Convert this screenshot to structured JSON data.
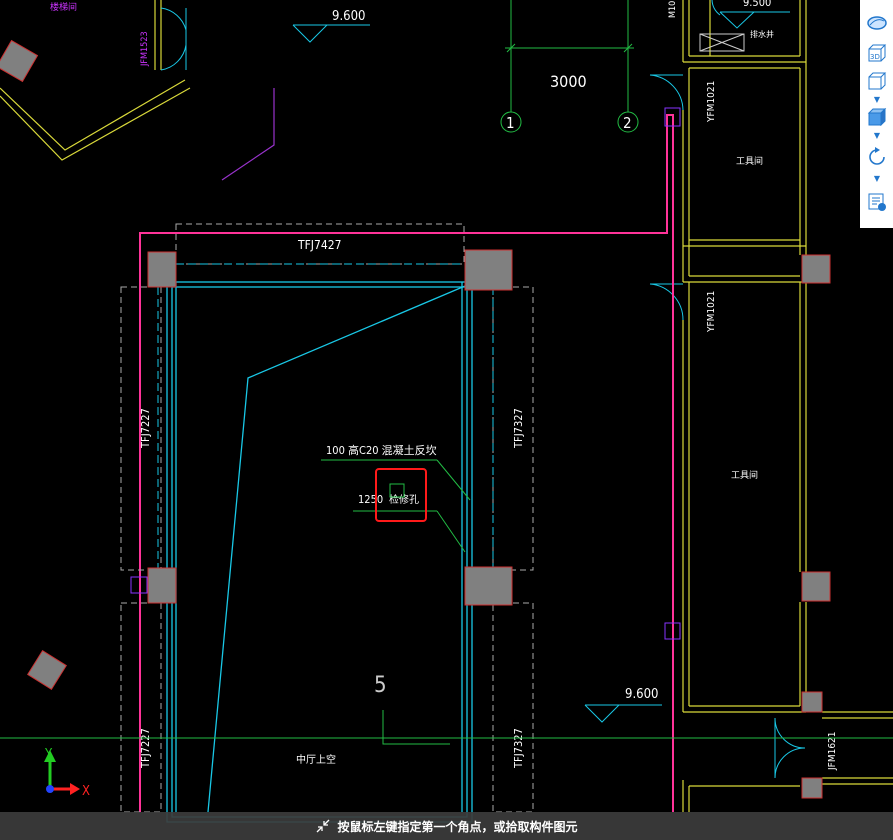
{
  "canvas": {
    "elevations": [
      "9.600",
      "9.600",
      "9.500"
    ],
    "dimension": "3000",
    "axes": [
      "1",
      "2"
    ],
    "room_number": "5",
    "beams": {
      "top": "TFJ7427",
      "left_upper": "TFJ7227",
      "right_upper": "TFJ7327",
      "left_lower": "TFJ7227",
      "right_lower": "TFJ7327"
    },
    "doors": {
      "right_upper": "YFM1021",
      "right_middle": "YFM1021",
      "left_top": "JFM1523",
      "right_lower": "JFM1621",
      "top_small": "M10"
    },
    "rooms": {
      "tool_room_1": "工具间",
      "tool_room_2": "工具间",
      "hall": "中厅上空",
      "well": "排水井"
    },
    "annotations": {
      "line1": "100 高C20 混凝土反坎",
      "line2_num": "1250",
      "line2_text": "检修孔"
    },
    "top_left_label": "楼梯间"
  },
  "toolbar": {
    "items": [
      "orbit",
      "3d",
      "box",
      "shaded-box",
      "rotate",
      "layer-settings"
    ],
    "label_3d": "3D"
  },
  "status_bar": {
    "message": "按鼠标左键指定第一个角点，或拾取构件图元"
  },
  "ucs": {
    "x_label": "X",
    "y_label": "Y"
  },
  "colors": {
    "background": "#000000",
    "wall": "#d9d93a",
    "column_fill": "#808080",
    "column_stroke": "#cc3030",
    "pipe": "#ff3399",
    "beam_cyan": "#19c8e6",
    "highlight": "#ff1a1a"
  }
}
